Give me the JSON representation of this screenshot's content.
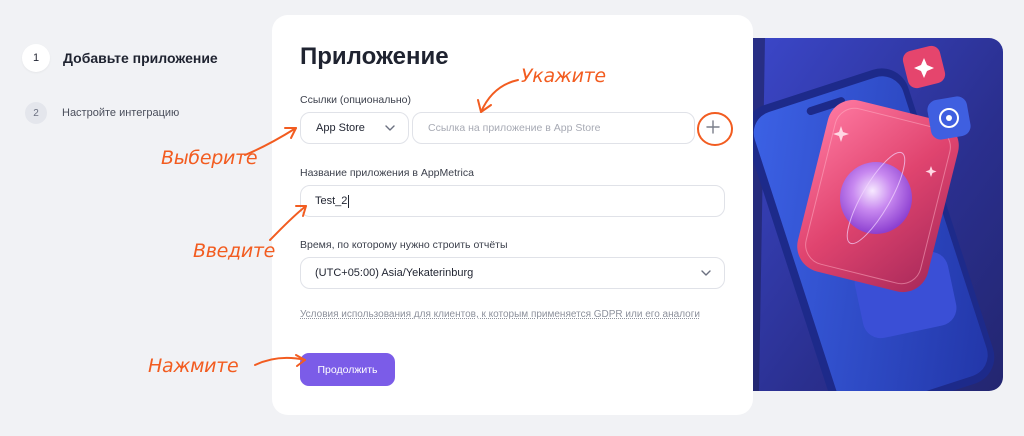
{
  "steps": [
    {
      "number": "1",
      "label": "Добавьте приложение"
    },
    {
      "number": "2",
      "label": "Настройте интеграцию"
    }
  ],
  "form": {
    "title": "Приложение",
    "links_label": "Ссылки (опционально)",
    "store_value": "App Store",
    "url_placeholder": "Ссылка на приложение в App Store",
    "name_label": "Название приложения в AppMetrica",
    "name_value": "Test_2",
    "timezone_label": "Время, по которому нужно строить отчёты",
    "timezone_value": "(UTC+05:00) Asia/Yekaterinburg",
    "gdpr_link": "Условия использования для клиентов, к которым применяется GDPR или его аналоги",
    "continue_label": "Продолжить"
  },
  "annotations": {
    "specify": "Укажите",
    "choose": "Выберите",
    "enter": "Введите",
    "press": "Нажмите"
  },
  "colors": {
    "accent": "#7b5ce8",
    "annotation": "#f25c20",
    "background": "#f1f2f5"
  },
  "icons": {
    "store_dropdown": "chevron-down-icon",
    "add_link": "plus-icon",
    "timezone_dropdown": "chevron-down-icon"
  }
}
